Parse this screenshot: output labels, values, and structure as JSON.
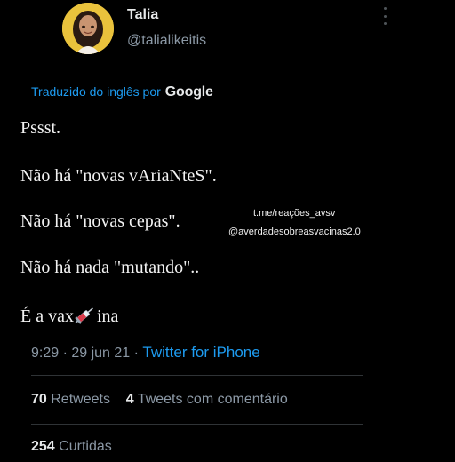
{
  "header": {
    "name": "Talia",
    "handle": "@talialikeitis"
  },
  "translation": {
    "label": "Traduzido do inglês por",
    "provider": "Google"
  },
  "tweet": {
    "lines": [
      "Pssst.",
      "Não há \"novas vAriaNteS\".",
      "Não há \"novas cepas\".",
      "Não há nada \"mutando\"..",
      "É a vax",
      "ina"
    ],
    "emoji": "syringe-icon"
  },
  "watermark": {
    "line1": "t.me/reações_avsv",
    "line2": "@averdadesobreasvacinas2.0"
  },
  "meta": {
    "time": "9:29",
    "separator1": " · ",
    "date": "29 jun 21",
    "separator2": " · ",
    "app": "Twitter for iPhone"
  },
  "stats": {
    "retweets_count": "70",
    "retweets_label": "Retweets",
    "quotes_count": "4",
    "quotes_label": "Tweets com comentário",
    "likes_count": "254",
    "likes_label": "Curtidas"
  },
  "colors": {
    "background": "#000000",
    "link": "#1d9bf0",
    "secondary_text": "#8b98a5",
    "avatar_bg": "#e9c23c"
  }
}
